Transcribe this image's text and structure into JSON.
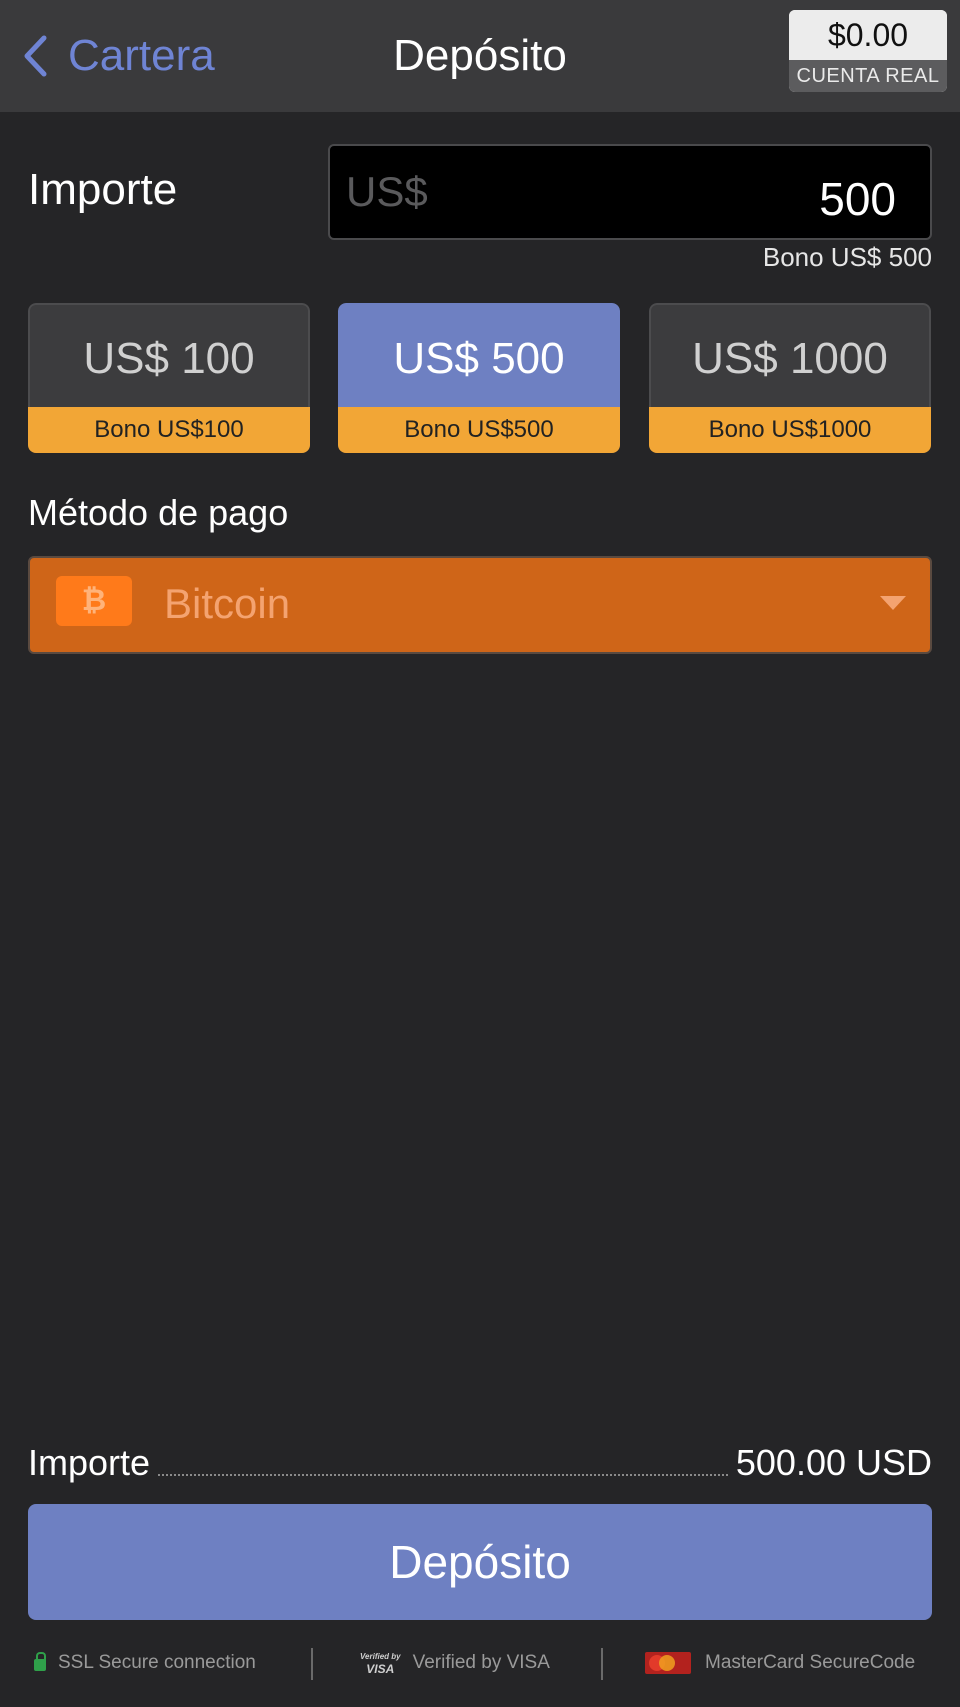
{
  "header": {
    "back_label": "Cartera",
    "title": "Depósito",
    "balance": "$0.00",
    "account_type": "CUENTA REAL"
  },
  "amount": {
    "label": "Importe",
    "currency_prefix": "US$",
    "value": "500",
    "bonus_note": "Bono US$ 500"
  },
  "presets": [
    {
      "label": "US$ 100",
      "bonus": "Bono US$100",
      "selected": false
    },
    {
      "label": "US$ 500",
      "bonus": "Bono US$500",
      "selected": true
    },
    {
      "label": "US$ 1000",
      "bonus": "Bono US$1000",
      "selected": false
    }
  ],
  "payment": {
    "label": "Método de pago",
    "method": "Bitcoin",
    "icon": "bitcoin-icon",
    "icon_glyph": "₿"
  },
  "summary": {
    "label": "Importe",
    "value": "500.00 USD"
  },
  "deposit_button": "Depósito",
  "footer": {
    "ssl": "SSL Secure connection",
    "visa_logo_top": "Verified by",
    "visa_logo_bottom": "VISA",
    "visa": "Verified by VISA",
    "mastercard": "MasterCard SecureCode"
  },
  "colors": {
    "accent": "#6e80c2",
    "bonus": "#f2a636",
    "bitcoin": "#cf6518",
    "background": "#252527"
  }
}
